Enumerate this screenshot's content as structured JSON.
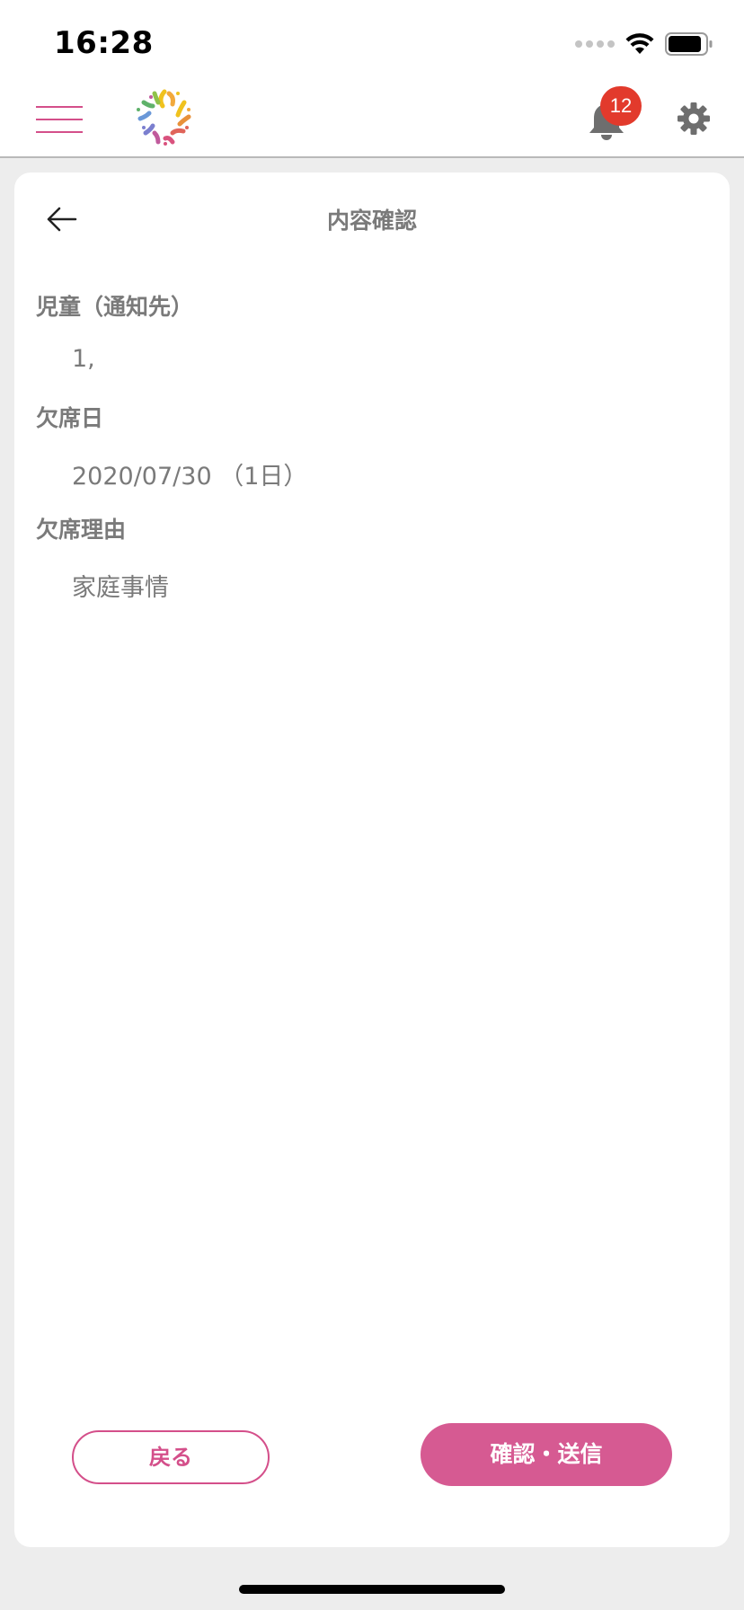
{
  "status_bar": {
    "time": "16:28"
  },
  "header": {
    "notification_count": "12",
    "accent_color": "#d44f8a"
  },
  "page": {
    "title": "内容確認",
    "fields": [
      {
        "label": "児童（通知先）",
        "value": "1,"
      },
      {
        "label": "欠席日",
        "value": "2020/07/30 （1日）"
      },
      {
        "label": "欠席理由",
        "value": "家庭事情"
      }
    ]
  },
  "actions": {
    "back_label": "戻る",
    "confirm_label": "確認・送信"
  },
  "icons": {
    "menu": "hamburger-icon",
    "logo": "flower-logo-icon",
    "notifications": "bell-icon",
    "settings": "gear-icon",
    "back": "arrow-left-icon"
  }
}
